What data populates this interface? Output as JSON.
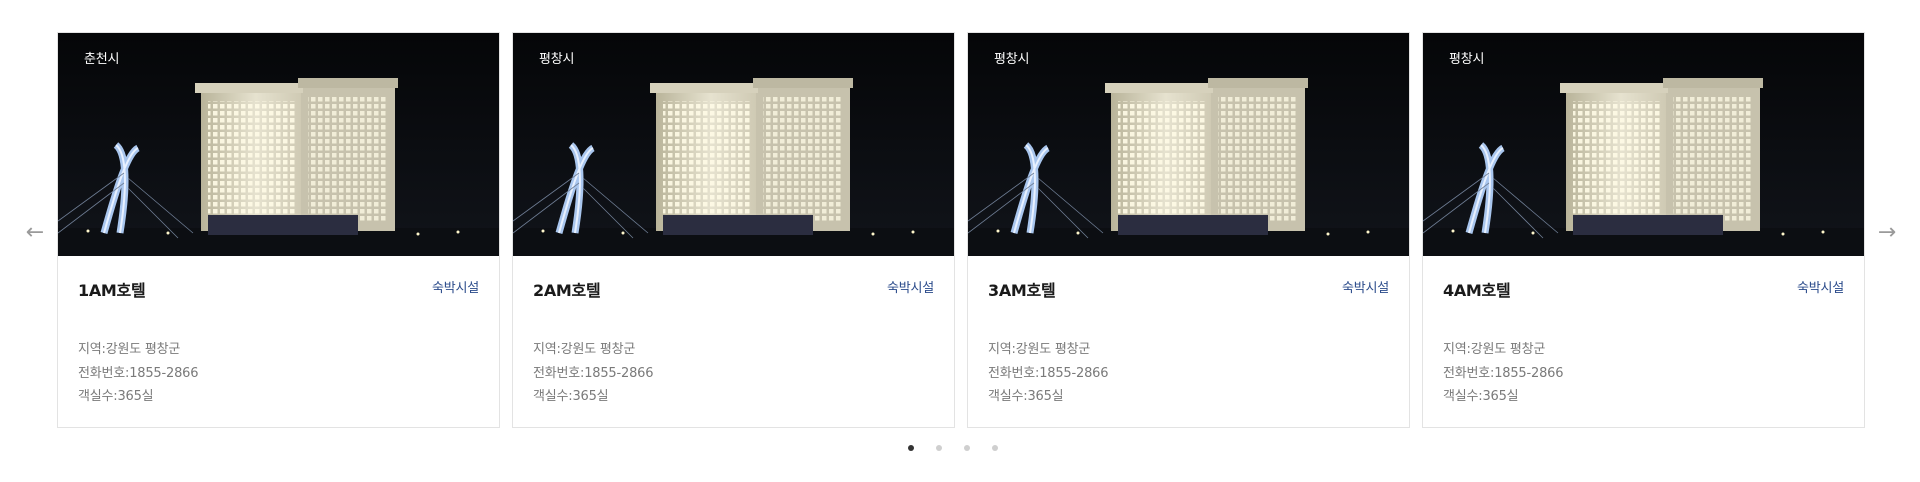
{
  "slider": {
    "prev_arrow": "←",
    "next_arrow": "→",
    "cards": [
      {
        "region": "춘천시",
        "name": "1AM호텔",
        "category": "숙박시설",
        "area": "지역:강원도 평창군",
        "phone": "전화번호:1855-2866",
        "rooms": "객실수:365실"
      },
      {
        "region": "평창시",
        "name": "2AM호텔",
        "category": "숙박시설",
        "area": "지역:강원도 평창군",
        "phone": "전화번호:1855-2866",
        "rooms": "객실수:365실"
      },
      {
        "region": "평창시",
        "name": "3AM호텔",
        "category": "숙박시설",
        "area": "지역:강원도 평창군",
        "phone": "전화번호:1855-2866",
        "rooms": "객실수:365실"
      },
      {
        "region": "평창시",
        "name": "4AM호텔",
        "category": "숙박시설",
        "area": "지역:강원도 평창군",
        "phone": "전화번호:1855-2866",
        "rooms": "객실수:365실"
      }
    ],
    "pagination": {
      "count": 4,
      "active": 1
    }
  },
  "colors": {
    "category_text": "#2a4a8a",
    "info_text": "#7a7a7a",
    "card_border": "#e3e3e3",
    "dot_active": "#333333",
    "dot_inactive": "#cfcfcf"
  }
}
